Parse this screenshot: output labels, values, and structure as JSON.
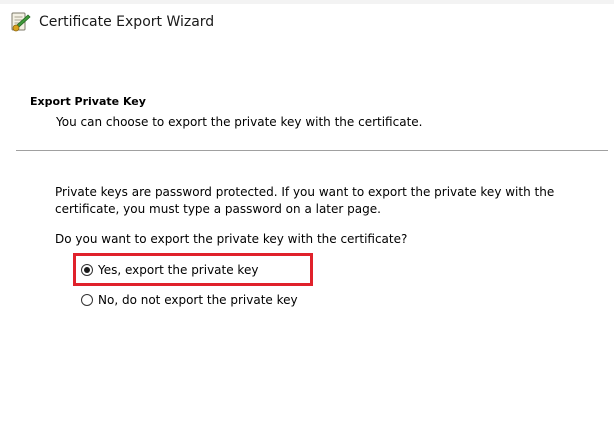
{
  "window": {
    "title": "Certificate Export Wizard",
    "icon": "certificate-wizard-icon"
  },
  "section": {
    "heading": "Export Private Key",
    "subtitle": "You can choose to export the private key with the certificate."
  },
  "body": {
    "description": "Private keys are password protected. If you want to export the private key with the certificate, you must type a password on a later page.",
    "question": "Do you want to export the private key with the certificate?"
  },
  "options": [
    {
      "label": "Yes, export the private key",
      "selected": true
    },
    {
      "label": "No, do not export the private key",
      "selected": false
    }
  ],
  "colors": {
    "highlight": "#e0212b",
    "divider": "#a0a0a0"
  }
}
